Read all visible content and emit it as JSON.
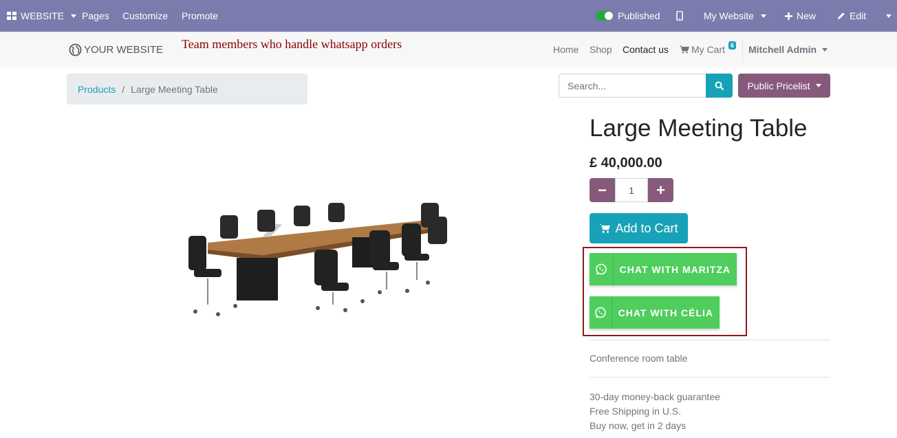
{
  "admin_bar": {
    "website_label": "WEBSITE",
    "pages_label": "Pages",
    "customize_label": "Customize",
    "promote_label": "Promote",
    "published_label": "Published",
    "my_website_label": "My Website",
    "new_label": "New",
    "edit_label": "Edit"
  },
  "header": {
    "logo_text": "YOUR WEBSITE",
    "annotation": "Team members who handle whatsapp orders",
    "nav": {
      "home": "Home",
      "shop": "Shop",
      "contact": "Contact us",
      "cart": "My Cart",
      "cart_count": "6",
      "user": "Mitchell Admin"
    }
  },
  "breadcrumb": {
    "parent": "Products",
    "separator": "/",
    "current": "Large Meeting Table"
  },
  "search": {
    "placeholder": "Search..."
  },
  "pricelist_label": "Public Pricelist",
  "product": {
    "title": "Large Meeting Table",
    "price": "£ 40,000.00",
    "quantity": "1",
    "minus_label": "−",
    "plus_label": "+",
    "add_to_cart": "Add to Cart",
    "whatsapp_buttons": [
      "CHAT WITH MARITZA",
      "CHAT WITH CÉLIA"
    ],
    "description": "Conference room table",
    "policies": [
      "30-day money-back guarantee",
      "Free Shipping in U.S.",
      "Buy now, get in 2 days"
    ]
  },
  "colors": {
    "admin_bar": "#7c7bad",
    "primary": "#17a2b8",
    "secondary": "#875a7b",
    "whatsapp": "#4fce5d",
    "annotation": "#8b0000"
  },
  "icons": {
    "apps": "grid-icon",
    "mobile": "mobile-icon",
    "plus": "plus-icon",
    "edit": "pencil-icon",
    "globe": "globe-icon",
    "cart": "cart-icon",
    "search": "search-icon",
    "whatsapp": "whatsapp-icon"
  }
}
